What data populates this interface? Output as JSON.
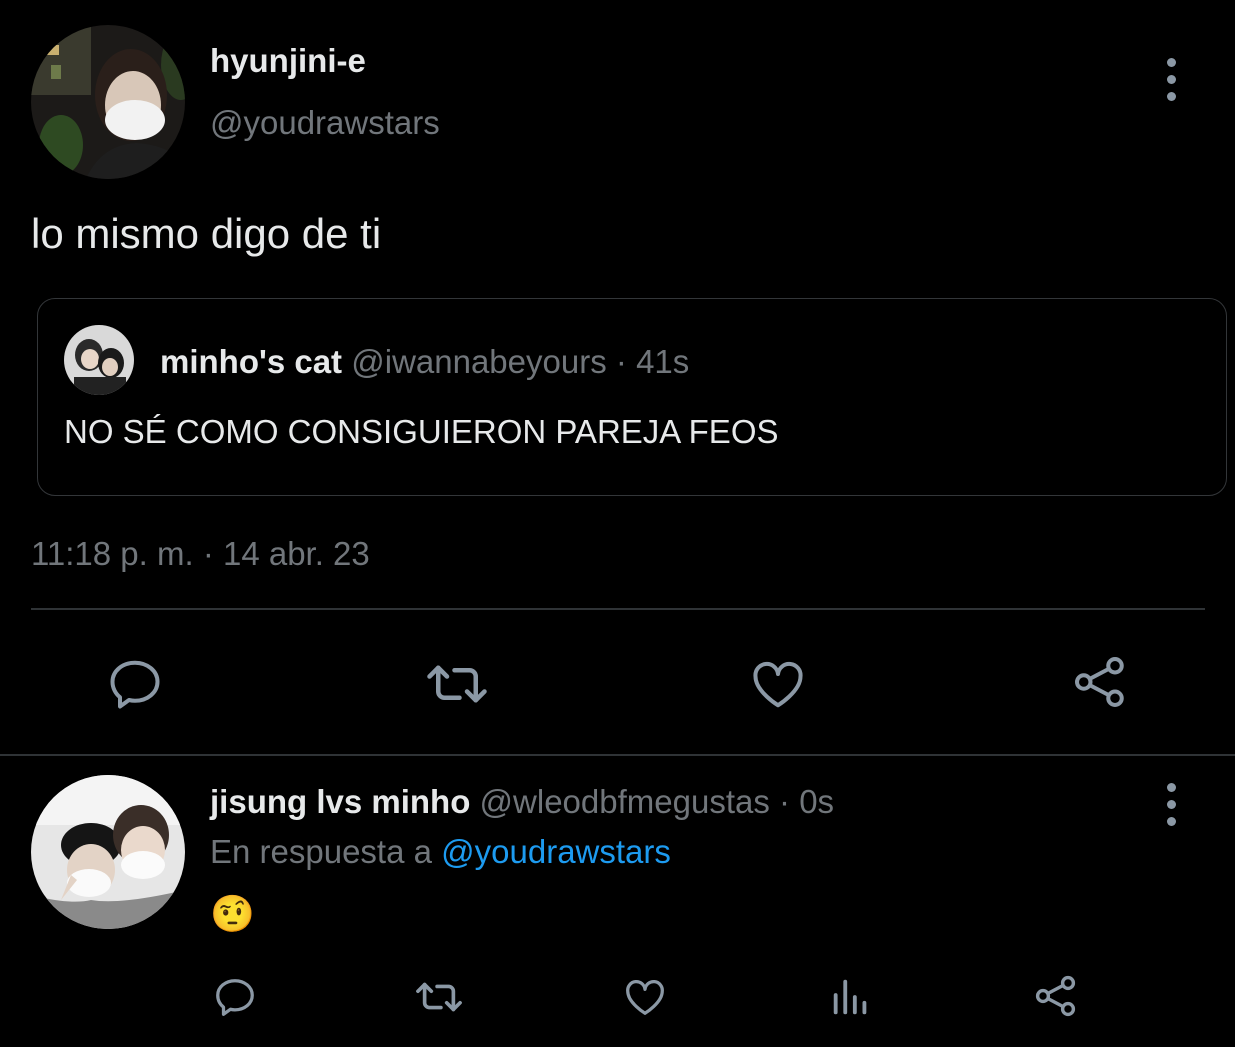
{
  "main_tweet": {
    "display_name": "hyunjini-e",
    "handle": "@youdrawstars",
    "text": "lo mismo digo de ti",
    "timestamp": "11:18 p. m. · 14 abr. 23",
    "avatar_icon": "profile-photo",
    "more_icon": "more-vertical-icon",
    "quoted": {
      "display_name": "minho's cat",
      "handle": "@iwannabeyours",
      "separator": "·",
      "age": "41s",
      "text": "NO SÉ COMO CONSIGUIERON PAREJA FEOS"
    },
    "actions": [
      "reply-icon",
      "retweet-icon",
      "like-icon",
      "share-icon"
    ]
  },
  "reply_tweet": {
    "display_name": "jisung lvs minho",
    "handle": "@wleodbfmegustas",
    "separator": "·",
    "age": "0s",
    "reply_prefix": "En respuesta a",
    "reply_to": "@youdrawstars",
    "text": "🤨",
    "actions": [
      "reply-icon",
      "retweet-icon",
      "like-icon",
      "analytics-icon",
      "share-icon"
    ]
  },
  "colors": {
    "background": "#000000",
    "text": "#e7e9ea",
    "muted": "#71767b",
    "link": "#1d9bf0",
    "divider": "#2f3336"
  }
}
